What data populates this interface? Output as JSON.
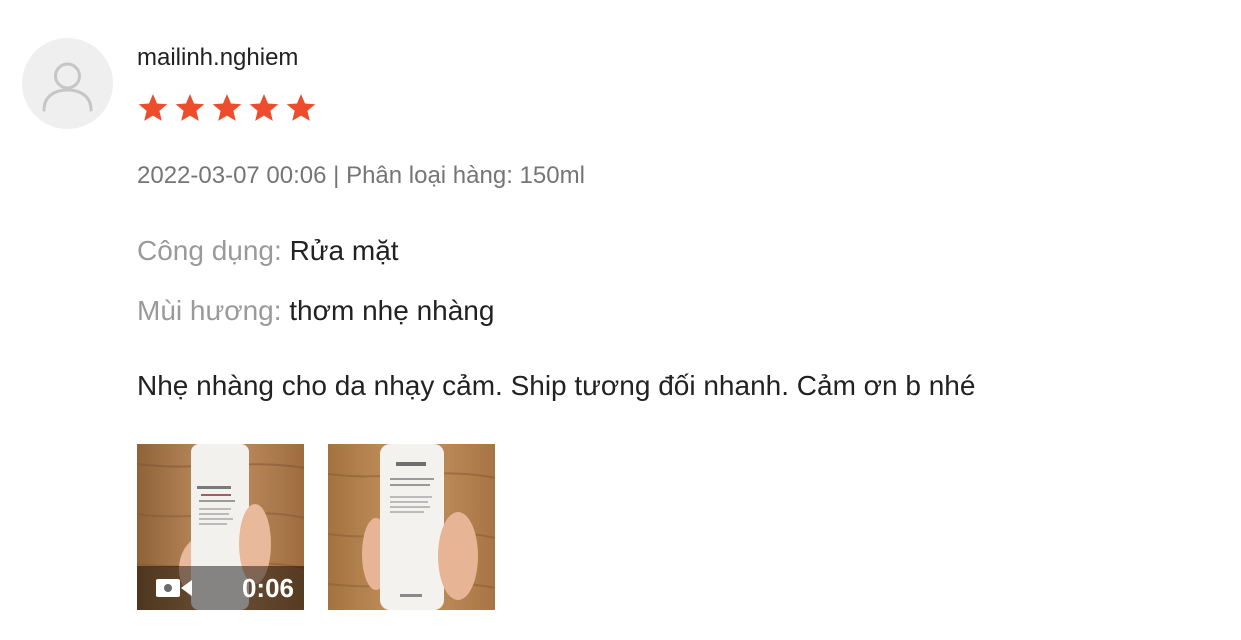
{
  "review": {
    "username": "mailinh.nghiem",
    "rating": 5,
    "rating_max": 5,
    "star_color": "#ee4d2d",
    "meta": "2022-03-07 00:06 | Phân loại hàng: 150ml",
    "attributes": [
      {
        "label": "Công dụng:",
        "value": "Rửa mặt"
      },
      {
        "label": "Mùi hương:",
        "value": "thơm nhẹ nhàng"
      }
    ],
    "comment": "Nhẹ nhàng cho da nhạy cảm. Ship tương đối nhanh. Cảm ơn b nhé",
    "media": [
      {
        "kind": "video",
        "duration": "0:06",
        "icon": "video-camera-icon"
      },
      {
        "kind": "image"
      }
    ]
  }
}
